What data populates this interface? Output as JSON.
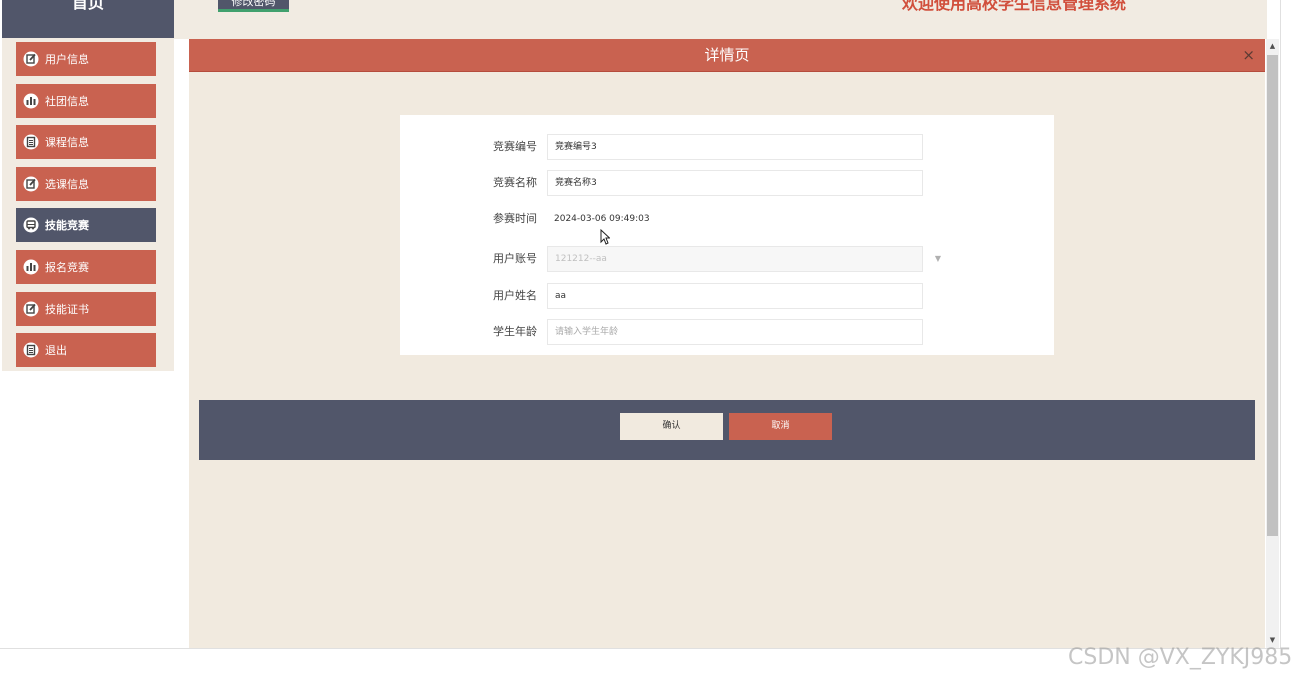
{
  "header": {
    "home_label": "首页",
    "change_password_label": "修改密码",
    "welcome_text": "欢迎使用高校学生信息管理系统"
  },
  "sidebar": {
    "items": [
      {
        "label": "用户信息",
        "icon": "edit-icon",
        "active": false
      },
      {
        "label": "社团信息",
        "icon": "bar-chart-icon",
        "active": false
      },
      {
        "label": "课程信息",
        "icon": "clipboard-icon",
        "active": false
      },
      {
        "label": "选课信息",
        "icon": "edit-icon",
        "active": false
      },
      {
        "label": "技能竞赛",
        "icon": "bus-icon",
        "active": true
      },
      {
        "label": "报名竞赛",
        "icon": "bar-chart-icon",
        "active": false
      },
      {
        "label": "技能证书",
        "icon": "edit-icon",
        "active": false
      },
      {
        "label": "退出",
        "icon": "clipboard-icon",
        "active": false
      }
    ]
  },
  "modal": {
    "title": "详情页",
    "close_glyph": "×",
    "fields": {
      "competition_no": {
        "label": "竞赛编号",
        "value": "竞赛编号3"
      },
      "competition_name": {
        "label": "竞赛名称",
        "value": "竞赛名称3"
      },
      "entry_time": {
        "label": "参赛时间",
        "value": "2024-03-06 09:49:03"
      },
      "user_account": {
        "label": "用户账号",
        "value": "121212--aa"
      },
      "user_name": {
        "label": "用户姓名",
        "value": "aa"
      },
      "student_age": {
        "label": "学生年龄",
        "placeholder": "请输入学生年龄"
      }
    },
    "confirm_label": "确认",
    "cancel_label": "取消"
  },
  "watermark": "CSDN @VX_ZYKJ985",
  "colors": {
    "accent": "#c96250",
    "dark": "#51566a",
    "background": "#f1eadf",
    "welcome": "#d14f3c"
  }
}
